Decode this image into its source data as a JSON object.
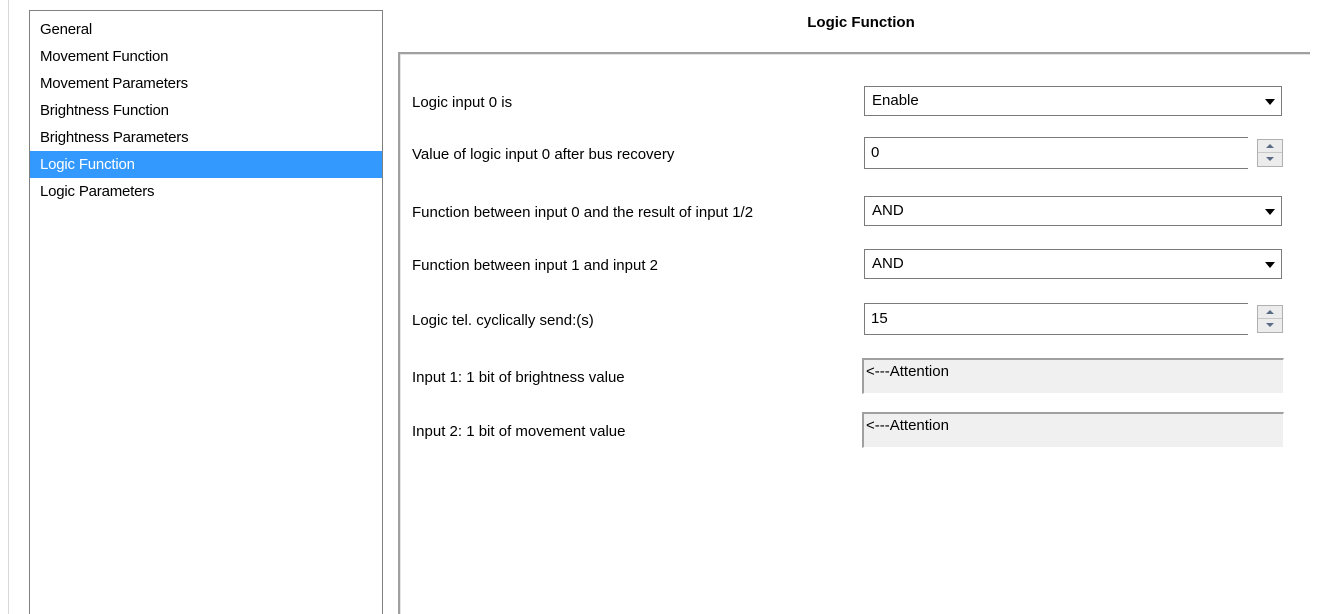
{
  "navigation": {
    "items": [
      {
        "label": "General",
        "selected": false
      },
      {
        "label": "Movement Function",
        "selected": false
      },
      {
        "label": "Movement Parameters",
        "selected": false
      },
      {
        "label": "Brightness Function",
        "selected": false
      },
      {
        "label": "Brightness Parameters",
        "selected": false
      },
      {
        "label": "Logic Function",
        "selected": true
      },
      {
        "label": "Logic Parameters",
        "selected": false
      }
    ]
  },
  "page": {
    "title": "Logic Function"
  },
  "parameters": {
    "logic_input_0": {
      "label": "Logic input 0 is",
      "value": "Enable"
    },
    "value_after_recovery": {
      "label": "Value of logic input 0 after bus recovery",
      "value": "0"
    },
    "function_input0_result": {
      "label": "Function between input 0 and the result of input 1/2",
      "value": "AND"
    },
    "function_input1_input2": {
      "label": "Function between input 1 and input 2",
      "value": "AND"
    },
    "cyclic_send": {
      "label": "Logic tel. cyclically send:(s)",
      "value": "15"
    },
    "input1_info": {
      "label": "Input 1: 1 bit of brightness value",
      "value": "<---Attention"
    },
    "input2_info": {
      "label": "Input 2: 1 bit of movement value",
      "value": "<---Attention"
    }
  },
  "colors": {
    "selection_bg": "#3399ff",
    "selection_text": "#ffffff",
    "readonly_bg": "#f0f0f0"
  }
}
